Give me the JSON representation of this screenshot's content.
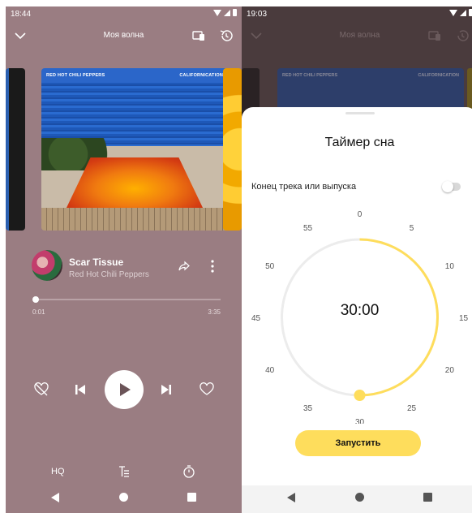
{
  "left": {
    "status_time": "18:44",
    "header_title": "Моя волна",
    "album": {
      "band_text": "RED HOT CHILI PEPPERS",
      "album_text": "CALIFORNICATION"
    },
    "track": {
      "title": "Scar Tissue",
      "artist": "Red Hot Chili Peppers"
    },
    "progress": {
      "current": "0:01",
      "total": "3:35",
      "fraction": 0.005
    },
    "tools": {
      "quality_label": "HQ"
    }
  },
  "right": {
    "status_time": "19:03",
    "header_title": "Моя волна",
    "album": {
      "band_text": "RED HOT CHILI PEPPERS",
      "album_text": "CALIFORNICATION"
    },
    "sheet": {
      "title": "Таймер сна",
      "option_label": "Конец трека или выпуска",
      "option_enabled": false,
      "timer_value": "30:00",
      "selected_minutes": 30,
      "dial_labels": [
        "0",
        "5",
        "10",
        "15",
        "20",
        "25",
        "30",
        "35",
        "40",
        "45",
        "50",
        "55"
      ],
      "start_button": "Запустить"
    }
  },
  "colors": {
    "player_bg": "#9a7d82",
    "accent_yellow": "#fedd5c",
    "dial_track": "#ececec"
  }
}
